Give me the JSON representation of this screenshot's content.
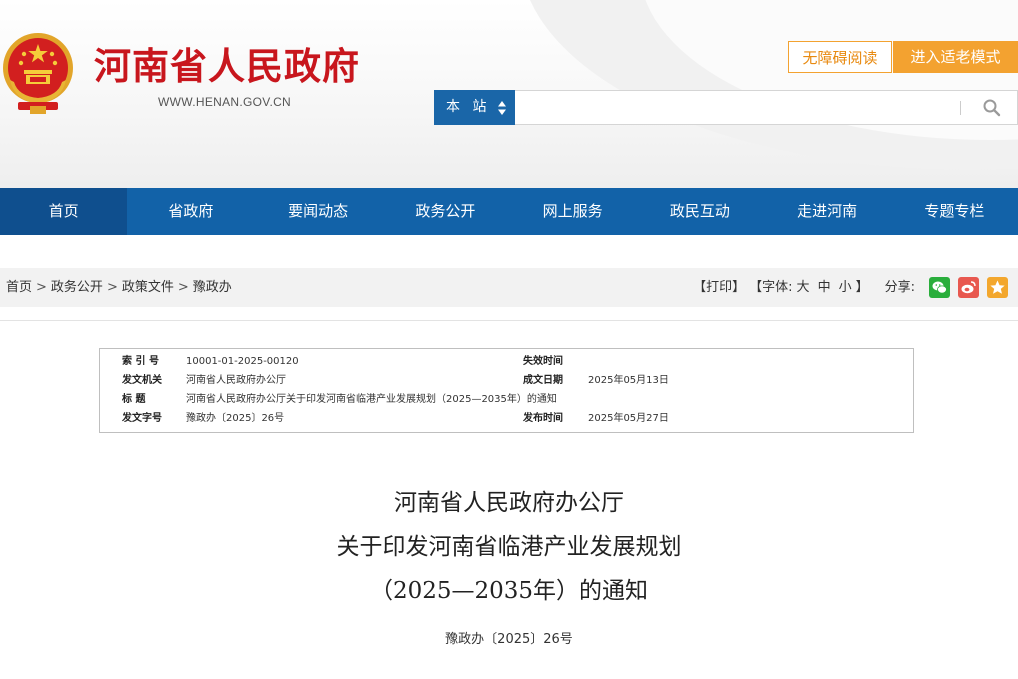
{
  "header": {
    "site_name": "河南省人民政府",
    "site_url": "WWW.HENAN.GOV.CN",
    "accessible_label": "无障碍阅读",
    "elderly_label": "进入适老模式",
    "search_scope": "本 站",
    "search_value": "",
    "search_placeholder": ""
  },
  "nav": {
    "items": [
      "首页",
      "省政府",
      "要闻动态",
      "政务公开",
      "网上服务",
      "政民互动",
      "走进河南",
      "专题专栏"
    ],
    "active_index": 0
  },
  "breadcrumb": [
    "首页",
    "政务公开",
    "政策文件",
    "豫政办"
  ],
  "breadcrumb_sep": ">",
  "tools": {
    "print": "【打印】",
    "font_label": "【字体:",
    "font_large": "大",
    "font_medium": "中",
    "font_small": "小",
    "font_close": "】",
    "share_label": "分享:"
  },
  "share_icons": [
    "wechat-icon",
    "weibo-icon",
    "favorite-icon"
  ],
  "meta": {
    "index_label": "索  引  号",
    "index_value": "10001-01-2025-00120",
    "expire_label": "失效时间",
    "expire_value": "",
    "issuer_label": "发文机关",
    "issuer_value": "河南省人民政府办公厅",
    "written_label": "成文日期",
    "written_value": "2025年05月13日",
    "title_label": "标      题",
    "title_value": "河南省人民政府办公厅关于印发河南省临港产业发展规划（2025—2035年）的通知",
    "doc_no_label": "发文字号",
    "doc_no_value": "豫政办〔2025〕26号",
    "publish_label": "发布时间",
    "publish_value": "2025年05月27日"
  },
  "article": {
    "title_lines": [
      "河南省人民政府办公厅",
      "关于印发河南省临港产业发展规划",
      "（2025—2035年）的通知"
    ],
    "doc_number": "豫政办〔2025〕26号"
  },
  "colors": {
    "brand_red": "#c8161d",
    "nav_blue": "#1262a8",
    "nav_active": "#0f4f8e",
    "accent_orange": "#f3a230",
    "wechat_green": "#2aae3c",
    "weibo_red": "#e8584f",
    "favorite_yellow": "#f3a72d"
  }
}
